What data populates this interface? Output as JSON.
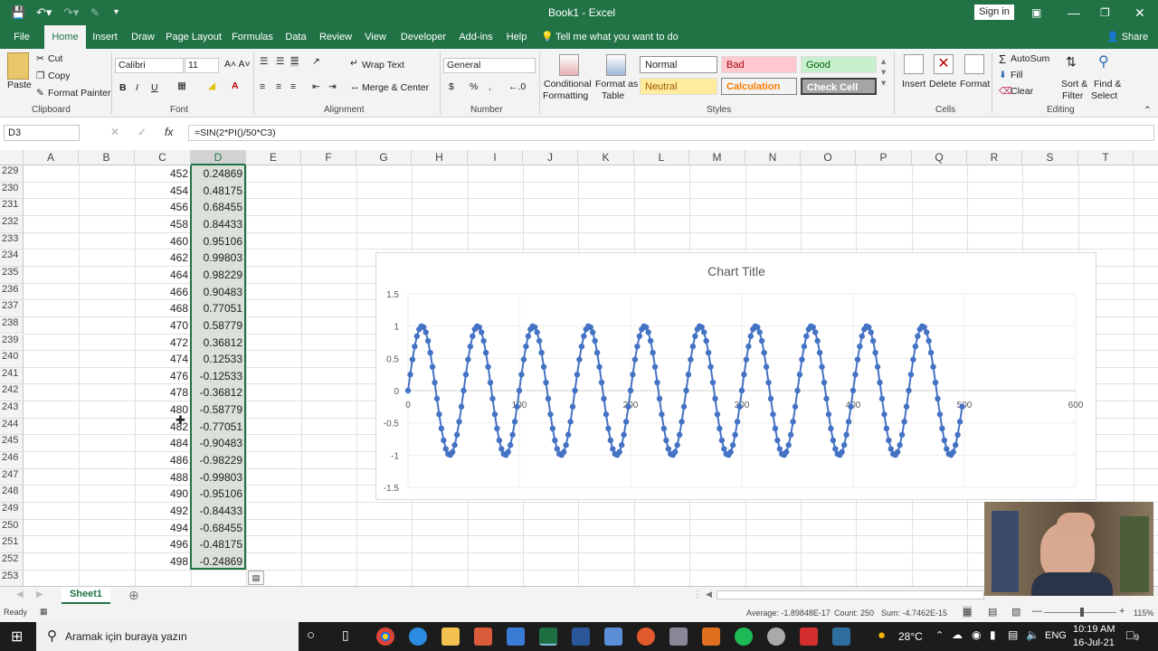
{
  "title_bar": {
    "doc_title": "Book1 - Excel",
    "sign_in": "Sign in"
  },
  "tabs": [
    "File",
    "Home",
    "Insert",
    "Draw",
    "Page Layout",
    "Formulas",
    "Data",
    "Review",
    "View",
    "Developer",
    "Add-ins",
    "Help"
  ],
  "tell_me": "Tell me what you want to do",
  "share": "Share",
  "ribbon": {
    "clipboard": {
      "paste": "Paste",
      "cut": "Cut",
      "copy": "Copy",
      "format_painter": "Format Painter",
      "label": "Clipboard"
    },
    "font": {
      "name": "Calibri",
      "size": "11",
      "label": "Font",
      "bold": "B",
      "italic": "I",
      "underline": "U"
    },
    "alignment": {
      "wrap": "Wrap Text",
      "merge": "Merge & Center",
      "label": "Alignment"
    },
    "number": {
      "format": "General",
      "label": "Number",
      "currency": "$",
      "percent": "%",
      "comma": ","
    },
    "styles": {
      "cond1": "Conditional",
      "cond2": "Formatting",
      "fmt1": "Format as",
      "fmt2": "Table",
      "normal": "Normal",
      "bad": "Bad",
      "good": "Good",
      "neutral": "Neutral",
      "calculation": "Calculation",
      "check": "Check Cell",
      "label": "Styles"
    },
    "cells": {
      "insert": "Insert",
      "delete": "Delete",
      "format": "Format",
      "label": "Cells"
    },
    "editing": {
      "autosum": "AutoSum",
      "fill": "Fill",
      "clear": "Clear",
      "sort1": "Sort &",
      "sort2": "Filter",
      "find1": "Find &",
      "find2": "Select",
      "label": "Editing"
    }
  },
  "formula_bar": {
    "name_box": "D3",
    "fx": "fx",
    "formula": "=SIN(2*PI()/50*C3)"
  },
  "columns": [
    "A",
    "B",
    "C",
    "D",
    "E",
    "F",
    "G",
    "H",
    "I",
    "J",
    "K",
    "L",
    "M",
    "N",
    "O",
    "P",
    "Q",
    "R",
    "S",
    "T"
  ],
  "rows": [
    {
      "n": "229",
      "c": "452",
      "d": "0.24869"
    },
    {
      "n": "230",
      "c": "454",
      "d": "0.48175"
    },
    {
      "n": "231",
      "c": "456",
      "d": "0.68455"
    },
    {
      "n": "232",
      "c": "458",
      "d": "0.84433"
    },
    {
      "n": "233",
      "c": "460",
      "d": "0.95106"
    },
    {
      "n": "234",
      "c": "462",
      "d": "0.99803"
    },
    {
      "n": "235",
      "c": "464",
      "d": "0.98229"
    },
    {
      "n": "236",
      "c": "466",
      "d": "0.90483"
    },
    {
      "n": "237",
      "c": "468",
      "d": "0.77051"
    },
    {
      "n": "238",
      "c": "470",
      "d": "0.58779"
    },
    {
      "n": "239",
      "c": "472",
      "d": "0.36812"
    },
    {
      "n": "240",
      "c": "474",
      "d": "0.12533"
    },
    {
      "n": "241",
      "c": "476",
      "d": "-0.12533"
    },
    {
      "n": "242",
      "c": "478",
      "d": "-0.36812"
    },
    {
      "n": "243",
      "c": "480",
      "d": "-0.58779"
    },
    {
      "n": "244",
      "c": "482",
      "d": "-0.77051"
    },
    {
      "n": "245",
      "c": "484",
      "d": "-0.90483"
    },
    {
      "n": "246",
      "c": "486",
      "d": "-0.98229"
    },
    {
      "n": "247",
      "c": "488",
      "d": "-0.99803"
    },
    {
      "n": "248",
      "c": "490",
      "d": "-0.95106"
    },
    {
      "n": "249",
      "c": "492",
      "d": "-0.84433"
    },
    {
      "n": "250",
      "c": "494",
      "d": "-0.68455"
    },
    {
      "n": "251",
      "c": "496",
      "d": "-0.48175"
    },
    {
      "n": "252",
      "c": "498",
      "d": "-0.24869"
    },
    {
      "n": "253",
      "c": "",
      "d": ""
    }
  ],
  "chart_data": {
    "type": "scatter",
    "title": "Chart Title",
    "xlabel": "",
    "ylabel": "",
    "xlim": [
      0,
      600
    ],
    "ylim": [
      -1.5,
      1.5
    ],
    "x_ticks": [
      "0",
      "100",
      "200",
      "300",
      "400",
      "500",
      "600"
    ],
    "y_ticks": [
      "1.5",
      "1",
      "0.5",
      "0",
      "-0.5",
      "-1",
      "-1.5"
    ],
    "series_formula": "y = sin(2*pi/50*x)",
    "x_start": 0,
    "x_end": 498,
    "x_step": 2,
    "period": 50,
    "marker_color": "#4472C4",
    "line_color": "#4472C4",
    "grid": true,
    "legend": "none"
  },
  "sheet_tab": "Sheet1",
  "status": {
    "ready": "Ready",
    "average": "Average: -1.89848E-17",
    "count": "Count: 250",
    "sum": "Sum: -4.7462E-15",
    "zoom": "115%"
  },
  "taskbar": {
    "search": "Aramak için buraya yazın",
    "temp": "28°C",
    "lang": "ENG",
    "time": "10:19 AM",
    "date": "16-Jul-21",
    "notif": "9"
  },
  "colors": {
    "excel_green": "#217346",
    "selection_fill": "#d9e1d8",
    "chart_blue": "#4472C4"
  }
}
